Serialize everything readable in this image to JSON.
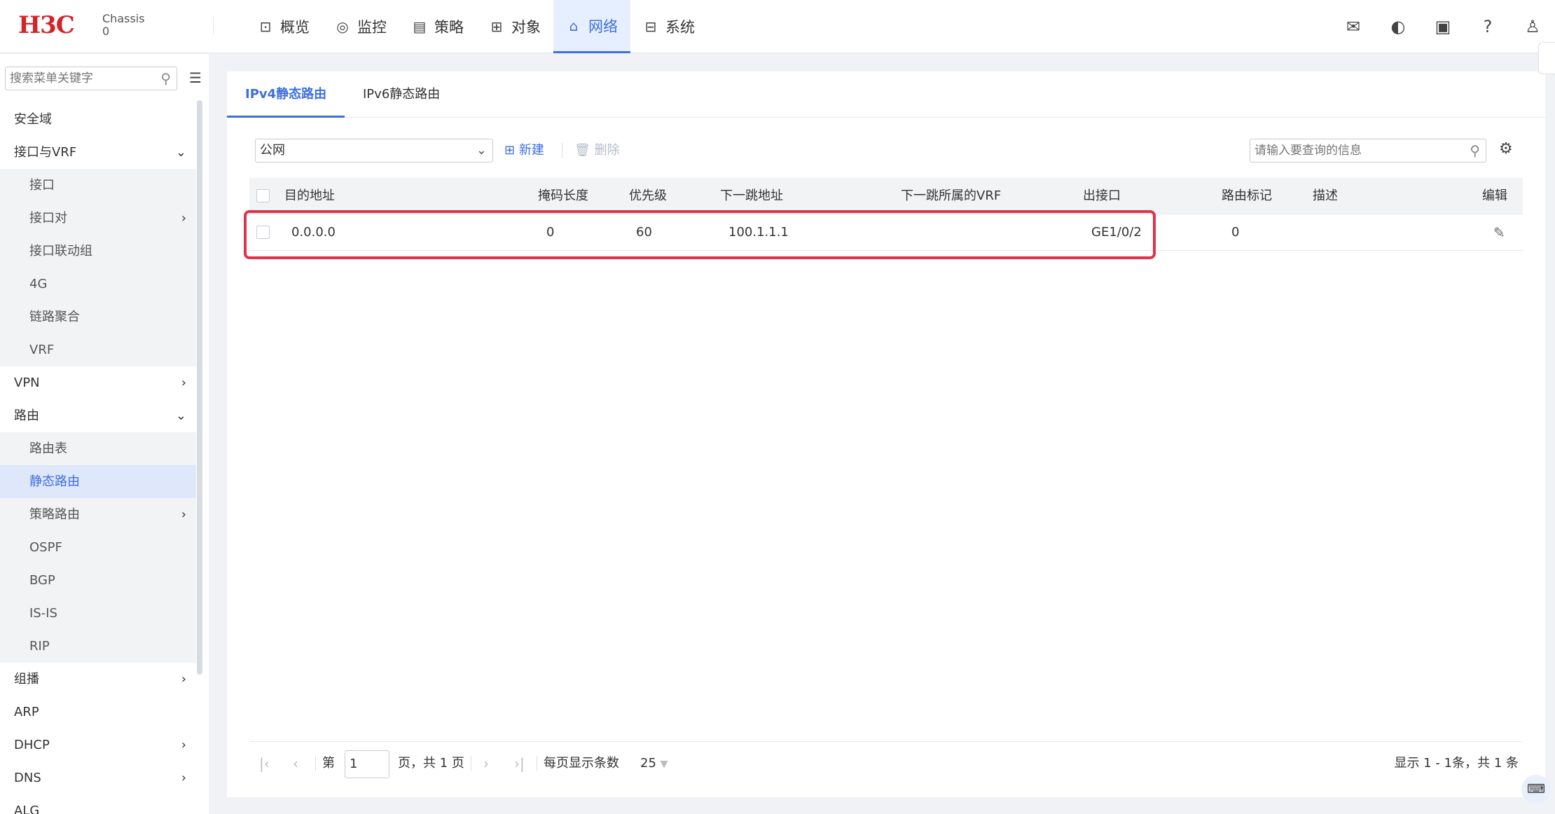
{
  "header": {
    "logo": "H3C",
    "chassis_line1": "Chassis",
    "chassis_line2": "0",
    "nav": [
      {
        "label": "概览",
        "icon": "monitor-icon"
      },
      {
        "label": "监控",
        "icon": "location-icon"
      },
      {
        "label": "策略",
        "icon": "clipboard-icon"
      },
      {
        "label": "对象",
        "icon": "grid-icon"
      },
      {
        "label": "网络",
        "icon": "network-icon",
        "active": true
      },
      {
        "label": "系统",
        "icon": "system-icon"
      }
    ],
    "actions": [
      "mailbox-icon",
      "palette-icon",
      "save-icon",
      "help-icon",
      "user-icon"
    ]
  },
  "sidebar": {
    "search_placeholder": "搜索菜单关键字",
    "items": [
      {
        "label": "安全域"
      },
      {
        "label": "接口与VRF",
        "expanded": true
      },
      {
        "label": "接口",
        "sub": true
      },
      {
        "label": "接口对",
        "sub": true,
        "has_children": true
      },
      {
        "label": "接口联动组",
        "sub": true
      },
      {
        "label": "4G",
        "sub": true
      },
      {
        "label": "链路聚合",
        "sub": true
      },
      {
        "label": "VRF",
        "sub": true
      },
      {
        "label": "VPN",
        "has_children": true
      },
      {
        "label": "路由",
        "expanded": true
      },
      {
        "label": "路由表",
        "sub": true
      },
      {
        "label": "静态路由",
        "sub": true,
        "selected": true
      },
      {
        "label": "策略路由",
        "sub": true,
        "has_children": true
      },
      {
        "label": "OSPF",
        "sub": true
      },
      {
        "label": "BGP",
        "sub": true
      },
      {
        "label": "IS-IS",
        "sub": true
      },
      {
        "label": "RIP",
        "sub": true
      },
      {
        "label": "组播",
        "has_children": true
      },
      {
        "label": "ARP"
      },
      {
        "label": "DHCP",
        "has_children": true
      },
      {
        "label": "DNS",
        "has_children": true
      },
      {
        "label": "ALG"
      }
    ]
  },
  "tabs": [
    {
      "label": "IPv4静态路由",
      "active": true
    },
    {
      "label": "IPv6静态路由"
    }
  ],
  "toolbar": {
    "vrf_value": "公网",
    "new_label": "新建",
    "delete_label": "删除",
    "query_placeholder": "请输入要查询的信息"
  },
  "table": {
    "headers": [
      "目的地址",
      "掩码长度",
      "优先级",
      "下一跳地址",
      "下一跳所属的VRF",
      "出接口",
      "路由标记",
      "描述",
      "编辑"
    ],
    "rows": [
      {
        "dest": "0.0.0.0",
        "mask": "0",
        "pref": "60",
        "nexthop": "100.1.1.1",
        "vrf": "",
        "iface": "GE1/0/2",
        "tag": "0",
        "desc": ""
      }
    ]
  },
  "pager": {
    "page_prefix": "第",
    "page_value": "1",
    "page_suffix": "页，共 1 页",
    "per_page_label": "每页显示条数",
    "per_page_value": "25",
    "summary": "显示 1 - 1条，共 1 条"
  },
  "colors": {
    "accent": "#3d6fe0",
    "brand": "#d52329",
    "highlight": "#e0324b"
  }
}
